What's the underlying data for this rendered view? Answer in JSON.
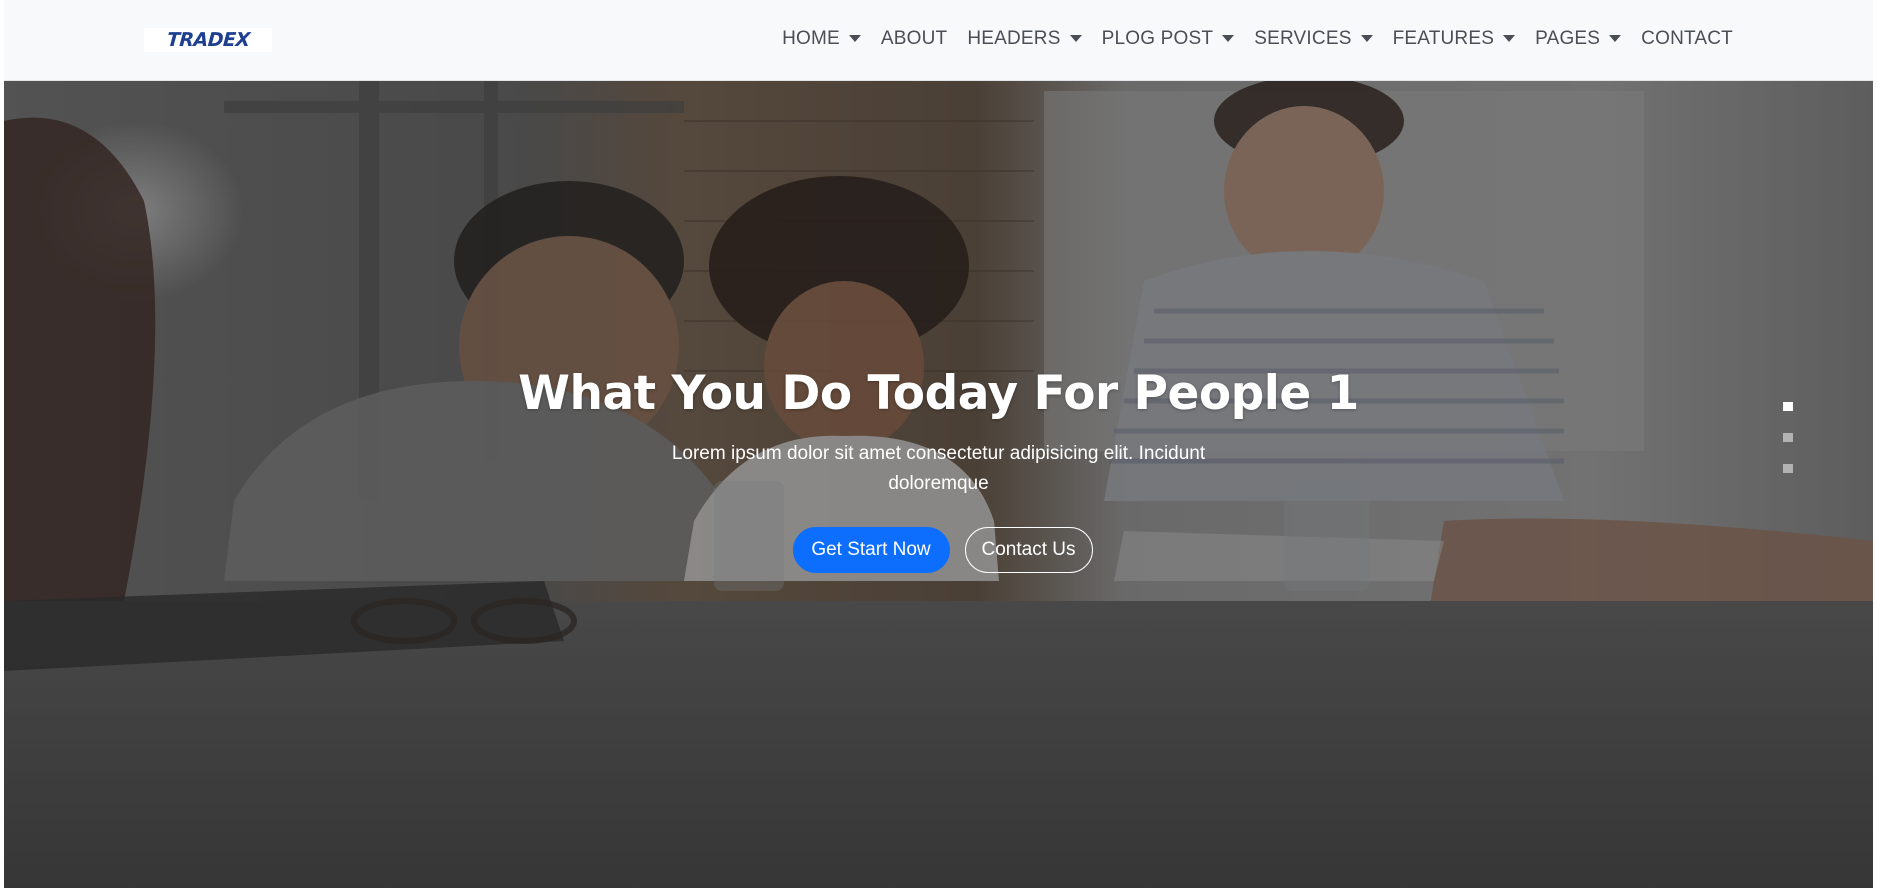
{
  "brand": {
    "logo_text": "TRADEX"
  },
  "nav": {
    "items": [
      {
        "label": "HOME",
        "dropdown": true
      },
      {
        "label": "ABOUT",
        "dropdown": false
      },
      {
        "label": "HEADERS",
        "dropdown": true
      },
      {
        "label": "PLOG POST",
        "dropdown": true
      },
      {
        "label": "SERVICES",
        "dropdown": true
      },
      {
        "label": "FEATURES",
        "dropdown": true
      },
      {
        "label": "PAGES",
        "dropdown": true
      },
      {
        "label": "CONTACT",
        "dropdown": false
      }
    ]
  },
  "hero": {
    "title": "What You Do Today For People 1",
    "text": "Lorem ipsum dolor sit amet consectetur adipisicing elit. Incidunt doloremque",
    "primary_button": "Get Start Now",
    "secondary_button": "Contact Us",
    "slides": 3,
    "active_slide": 1
  },
  "colors": {
    "primary": "#0d6efd",
    "navbar_bg": "#f8f9fa",
    "brand": "#1f3f8f"
  }
}
